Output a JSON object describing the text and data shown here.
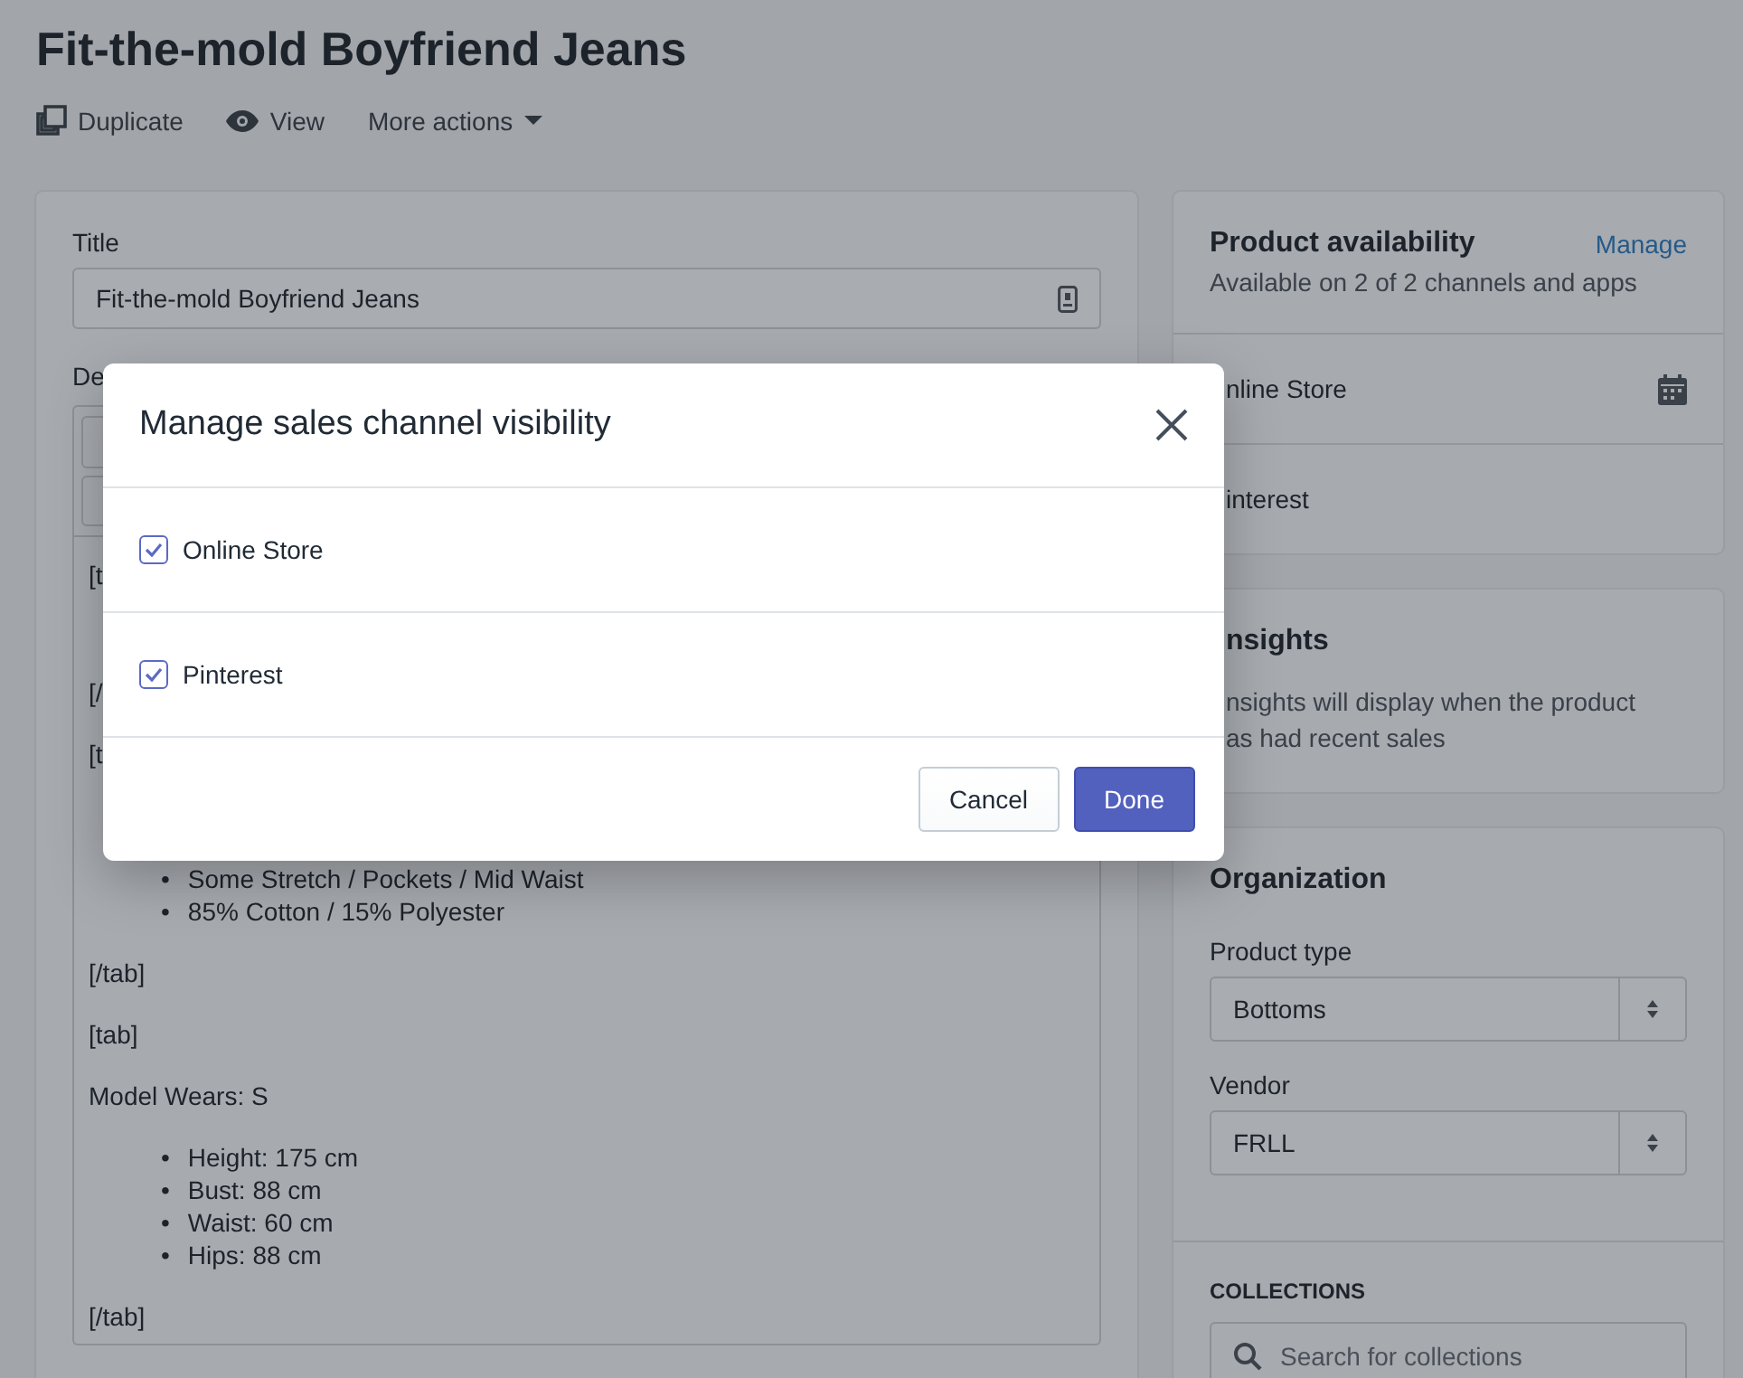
{
  "page": {
    "title": "Fit-the-mold Boyfriend Jeans",
    "actions": [
      {
        "label": "Duplicate",
        "kind": "duplicate"
      },
      {
        "label": "View",
        "kind": "view"
      },
      {
        "label": "More actions",
        "kind": "menu"
      }
    ]
  },
  "product": {
    "title_label": "Title",
    "title_value": "Fit-the-mold Boyfriend Jeans",
    "description_label": "De",
    "editor_blocks": [
      {
        "kind": "text",
        "text": "[t"
      },
      {
        "kind": "text",
        "text": "[/"
      },
      {
        "kind": "text",
        "text": "[t"
      },
      {
        "kind": "list",
        "marker": "•",
        "items": [
          "Some Stretch / Pockets / Mid Waist",
          "85% Cotton / 15% Polyester"
        ]
      },
      {
        "kind": "text",
        "text": "[/tab]"
      },
      {
        "kind": "text",
        "text": "[tab]"
      },
      {
        "kind": "text",
        "text": "Model Wears: S"
      },
      {
        "kind": "list",
        "marker": "•",
        "items": [
          "Height: 175 cm",
          "Bust: 88 cm",
          "Waist: 60 cm",
          "Hips: 88 cm"
        ]
      },
      {
        "kind": "text",
        "text": "[/tab]"
      }
    ]
  },
  "availability": {
    "title": "Product availability",
    "link": "Manage",
    "subtitle": "Available on 2 of 2 channels and apps",
    "channels": [
      {
        "label": "nline Store",
        "calendar": true
      },
      {
        "label": "interest",
        "calendar": false
      }
    ]
  },
  "insights": {
    "title": "nsights",
    "lines": [
      "nsights will display when the product",
      "as had recent sales"
    ]
  },
  "organization": {
    "title": "Organization",
    "selects": [
      {
        "label": "Product type",
        "value": "Bottoms"
      },
      {
        "label": "Vendor",
        "value": "FRLL"
      }
    ],
    "collections_label": "COLLECTIONS",
    "collections_placeholder": "Search for collections"
  },
  "dialog": {
    "title": "Manage sales channel visibility",
    "channels": [
      {
        "label": "Online Store",
        "checked": true
      },
      {
        "label": "Pinterest",
        "checked": true
      }
    ],
    "buttons": [
      {
        "label": "Cancel",
        "kind": "secondary"
      },
      {
        "label": "Done",
        "kind": "primary"
      }
    ]
  }
}
